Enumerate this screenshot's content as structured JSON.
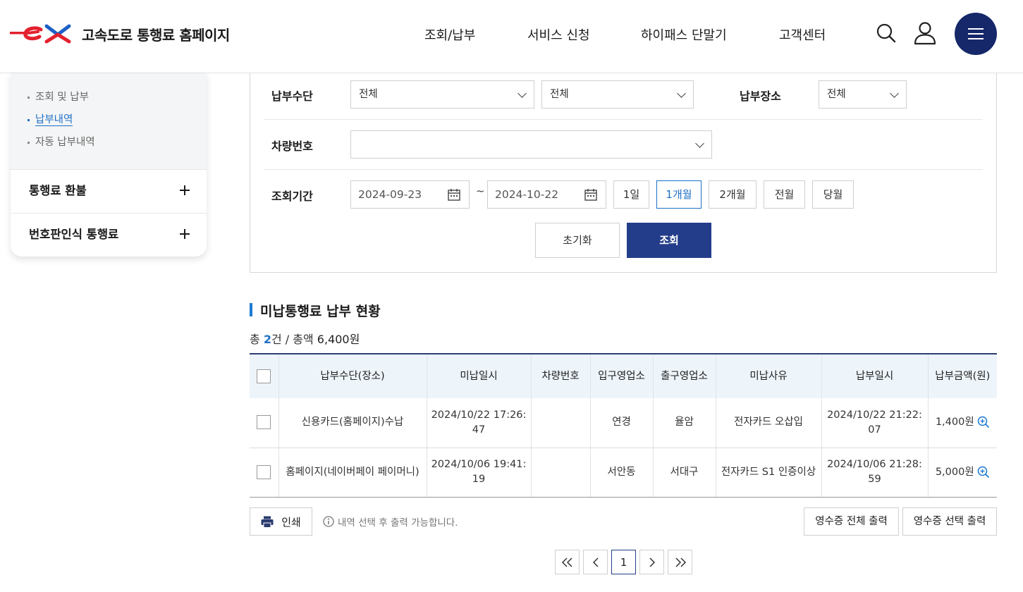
{
  "header": {
    "site_title": "고속도로 통행료 홈페이지",
    "nav": [
      "조회/납부",
      "서비스 신청",
      "하이패스 단말기",
      "고객센터"
    ],
    "icons": [
      "search-icon",
      "user-icon",
      "hamburger-menu-icon"
    ],
    "brand_color": "#16286a",
    "logo_red": "#e3212d"
  },
  "sidebar": {
    "sub_items": [
      {
        "label": "조회 및 납부",
        "active": false
      },
      {
        "label": "납부내역",
        "active": true
      },
      {
        "label": "자동 납부내역",
        "active": false
      }
    ],
    "sections": [
      "통행료 환불",
      "번호판인식 통행료"
    ]
  },
  "form": {
    "pay_method_label": "납부수단",
    "pay_method_value": "전체",
    "pay_method_sub_value": "전체",
    "pay_place_label": "납부장소",
    "pay_place_value": "전체",
    "car_no_label": "차량번호",
    "car_no_value": "",
    "period_label": "조회기간",
    "date_from": "2024-09-23",
    "date_sep": "~",
    "date_to": "2024-10-22",
    "period_buttons": [
      "1일",
      "1개월",
      "2개월",
      "전월",
      "당월"
    ],
    "period_selected": "1개월",
    "reset_label": "초기화",
    "search_label": "조회"
  },
  "result": {
    "section_title": "미납통행료 납부 현황",
    "summary_prefix": "총 ",
    "count": "2",
    "summary_mid": "건 / 총액 ",
    "total": "6,400원",
    "columns": [
      "납부수단(장소)",
      "미납일시",
      "차량번호",
      "입구영업소",
      "출구영업소",
      "미납사유",
      "납부일시",
      "납부금액(원)"
    ],
    "rows": [
      {
        "method": "신용카드(홈페이지)수납",
        "unpaid_at": "2024/10/22 17:26:47",
        "car_no": "",
        "entry": "연경",
        "exit": "율암",
        "reason": "전자카드 오삽입",
        "paid_at": "2024/10/22 21:22:07",
        "amount": "1,400원"
      },
      {
        "method": "홈페이지(네이버페이 페이머니)",
        "unpaid_at": "2024/10/06 19:41:19",
        "car_no": "",
        "entry": "서안동",
        "exit": "서대구",
        "reason": "전자카드 S1 인증이상",
        "paid_at": "2024/10/06 21:28:59",
        "amount": "5,000원"
      }
    ]
  },
  "actions": {
    "print_label": "인쇄",
    "info_text": "내역 선택 후 출력 가능합니다.",
    "receipt_all": "영수증 전체 출력",
    "receipt_selected": "영수증 선택 출력"
  },
  "pagination": {
    "current": "1",
    "icons": [
      "first-page-icon",
      "prev-page-icon",
      "next-page-icon",
      "last-page-icon"
    ]
  }
}
